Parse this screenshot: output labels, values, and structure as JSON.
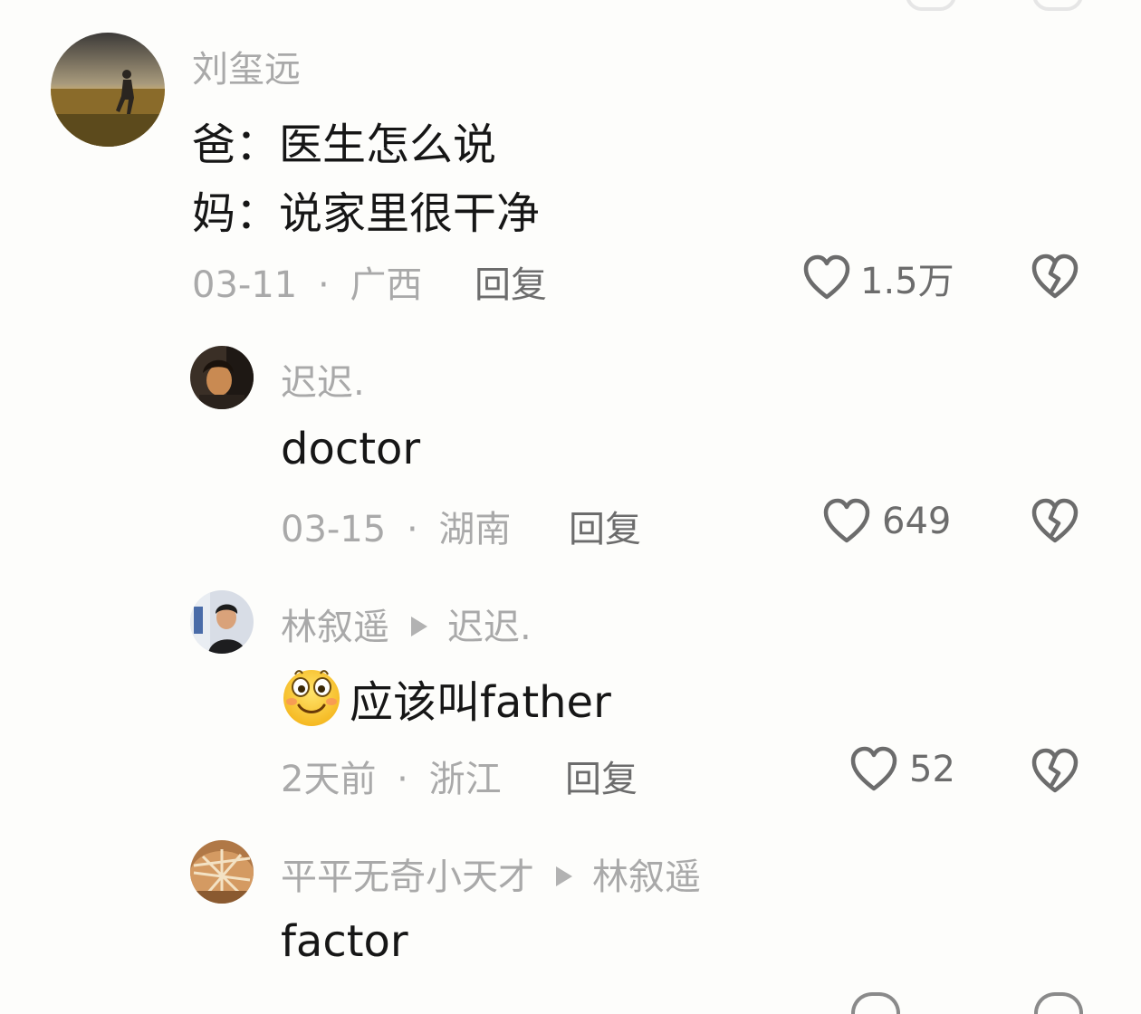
{
  "comments": [
    {
      "author": "刘玺远",
      "lines": [
        "爸：医生怎么说",
        "妈：说家里很干净"
      ],
      "date": "03-11",
      "location": "广西",
      "reply_label": "回复",
      "likes": "1.5万",
      "avatar": "field-runner-avatar"
    },
    {
      "author": "迟迟.",
      "text": "doctor",
      "date": "03-15",
      "location": "湖南",
      "reply_label": "回复",
      "likes": "649",
      "avatar": "portrait-avatar"
    },
    {
      "author": "林叙遥",
      "reply_to": "迟迟.",
      "emoji": "smile-emoji",
      "text": "应该叫father",
      "date": "2天前",
      "location": "浙江",
      "reply_label": "回复",
      "likes": "52",
      "avatar": "person-avatar"
    },
    {
      "author": "平平无奇小天才",
      "reply_to": "林叙遥",
      "text": "factor",
      "avatar": "bread-avatar"
    }
  ],
  "separator": "·",
  "icons": {
    "like": "heart-icon",
    "dislike": "broken-heart-icon"
  },
  "colors": {
    "meta": "#a9a9a9",
    "reply": "#6c6c6c",
    "text": "#161616",
    "background": "#fdfdfb"
  }
}
